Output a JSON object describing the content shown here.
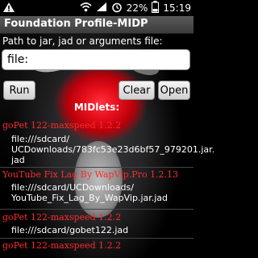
{
  "status": {
    "battery_percent": "22%",
    "time": "15:19",
    "icons": [
      "warning-icon",
      "wifi-icon",
      "signal-icon",
      "alarm-icon",
      "battery-icon"
    ]
  },
  "app": {
    "title": "Foundation Profile-MIDP"
  },
  "form": {
    "path_label": "Path to jar, jad or arguments file:",
    "path_value": "file:"
  },
  "buttons": {
    "run": "Run",
    "clear": "Clear",
    "open": "Open"
  },
  "midlets": {
    "header": "MIDlets:",
    "items": [
      {
        "title": "goPet 122-maxspeed 1.2.2",
        "path_line1": "file:///sdcard/",
        "path_line2": "UCDownloads/783fc53e23d6bf57_979201.jar.",
        "path_line3": "jad"
      },
      {
        "title": "YouTube Fix Lag By WapVip.Pro 1.2.13",
        "path_line1": "file:///sdcard/UCDownloads/",
        "path_line2": "YouTube_Fix_Lag_By_WapVip.jar.jad",
        "path_line3": ""
      },
      {
        "title": "goPet 122-maxspeed 1.2.2",
        "path_line1": "file:///sdcard/gobet122.jad",
        "path_line2": "",
        "path_line3": ""
      },
      {
        "title": "goPet 122-maxspeed 1.2.2",
        "path_line1": "",
        "path_line2": "",
        "path_line3": ""
      }
    ]
  },
  "colors": {
    "accent": "#ff2a2a"
  }
}
